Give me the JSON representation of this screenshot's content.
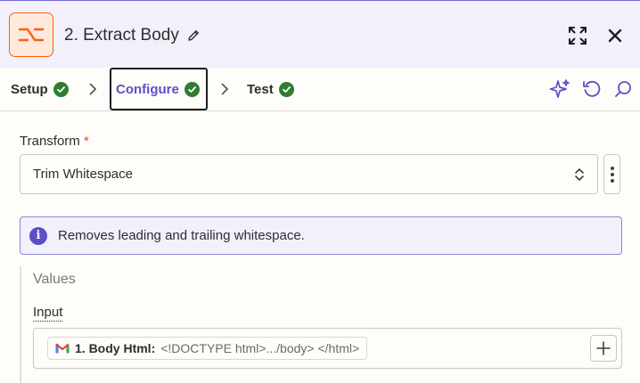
{
  "header": {
    "title": "2. Extract Body",
    "colors": {
      "bar": "#f2f1fb",
      "accent": "#ff5c0a"
    },
    "icons": [
      "formatter-app-icon",
      "pencil-icon",
      "expand-icon",
      "close-icon"
    ]
  },
  "tabs": [
    {
      "label": "Setup",
      "status": "complete"
    },
    {
      "label": "Configure",
      "status": "complete",
      "active": true
    },
    {
      "label": "Test",
      "status": "complete"
    }
  ],
  "toolbar": {
    "icons": [
      "sparkle-icon",
      "undo-icon",
      "search-icon"
    ]
  },
  "form": {
    "transform": {
      "label": "Transform",
      "required_mark": "*",
      "value": "Trim Whitespace"
    },
    "info_message": "Removes leading and trailing whitespace.",
    "values_section": {
      "title": "Values",
      "input": {
        "label": "Input",
        "token": {
          "app": "gmail-icon",
          "label": "1. Body Html:",
          "value": "<!DOCTYPE html>.../body>  </html>"
        }
      }
    }
  }
}
